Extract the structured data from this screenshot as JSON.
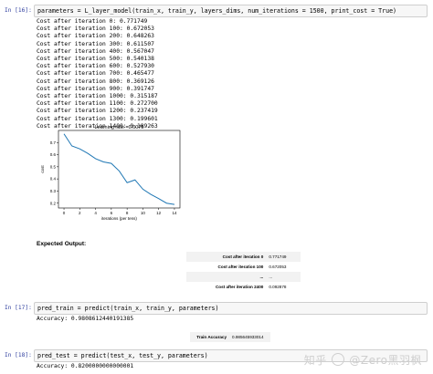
{
  "cells": [
    {
      "prompt": "In [16]:",
      "code": "parameters = L_layer_model(train_x, train_y, layers_dims, num_iterations = 1500, print_cost = True)"
    },
    {
      "prompt": "In [17]:",
      "code": "pred_train = predict(train_x, train_y, parameters)"
    },
    {
      "prompt": "In [18]:",
      "code": "pred_test = predict(test_x, test_y, parameters)"
    }
  ],
  "cost_lines": [
    "Cost after iteration 0: 0.771749",
    "Cost after iteration 100: 0.672053",
    "Cost after iteration 200: 0.648263",
    "Cost after iteration 300: 0.611507",
    "Cost after iteration 400: 0.567047",
    "Cost after iteration 500: 0.540138",
    "Cost after iteration 600: 0.527930",
    "Cost after iteration 700: 0.465477",
    "Cost after iteration 800: 0.369126",
    "Cost after iteration 900: 0.391747",
    "Cost after iteration 1000: 0.315187",
    "Cost after iteration 1100: 0.272700",
    "Cost after iteration 1200: 0.237419",
    "Cost after iteration 1300: 0.199601",
    "Cost after iteration 1400: 0.189263"
  ],
  "chart_data": {
    "type": "line",
    "title": "Learning rate =0.0075",
    "xlabel": "iterations (per tens)",
    "ylabel": "cost",
    "x": [
      0,
      1,
      2,
      3,
      4,
      5,
      6,
      7,
      8,
      9,
      10,
      11,
      12,
      13,
      14
    ],
    "series": [
      {
        "values": [
          0.771749,
          0.672053,
          0.648263,
          0.611507,
          0.567047,
          0.540138,
          0.52793,
          0.465477,
          0.369126,
          0.391747,
          0.315187,
          0.2727,
          0.237419,
          0.199601,
          0.189263
        ]
      }
    ],
    "xticks": [
      "0",
      "2",
      "4",
      "6",
      "8",
      "10",
      "12",
      "14"
    ],
    "yticks": [
      "0.2",
      "0.3",
      "0.4",
      "0.5",
      "0.6",
      "0.7"
    ],
    "xlim": [
      -0.7,
      14.7
    ],
    "ylim": [
      0.16,
      0.8
    ],
    "line_color": "#1f77b4",
    "grid": false
  },
  "expected_output_label": "Expected Output:",
  "expected_table": [
    {
      "k": "Cost after iteration 0",
      "v": "0.771749"
    },
    {
      "k": "Cost after iteration 100",
      "v": "0.672053"
    },
    {
      "k": "...",
      "v": "..."
    },
    {
      "k": "Cost after iteration 2400",
      "v": "0.092878"
    }
  ],
  "train_accuracy_output": "Accuracy: 0.9808612440191385",
  "train_accuracy_table": {
    "k": "Train Accuracy",
    "v": "0.985645933014"
  },
  "test_accuracy_output": "Accuracy: 0.8200000000000001",
  "watermark": {
    "prefix": "知乎",
    "handle": "@Zero黑羽枫"
  }
}
